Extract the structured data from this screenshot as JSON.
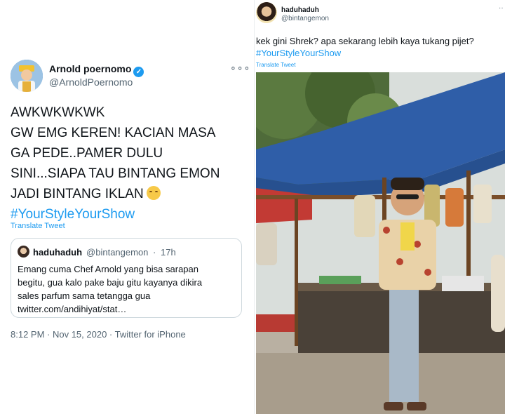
{
  "left_tweet": {
    "display_name": "Arnold poernomo",
    "verified_mark": "✓",
    "handle": "@ArnoldPoernomo",
    "more": "∘∘∘",
    "lines": [
      "AWKWKWKWK",
      "GW EMG KEREN! KACIAN MASA",
      "GA PEDE..PAMER DULU",
      "SINI...SIAPA TAU BINTANG EMON",
      "JADI BINTANG IKLAN"
    ],
    "hashtag": "#YourStyleYourShow",
    "translate": "Translate Tweet",
    "quoted": {
      "name": "haduhaduh",
      "handle": "@bintangemon",
      "separator": "·",
      "time": "17h",
      "lines": [
        "Emang cuma Chef Arnold yang bisa sarapan",
        "begitu, gua kalo pake baju gitu kayanya dikira",
        "sales parfum sama tetangga gua",
        "twitter.com/andihiyat/stat…"
      ]
    },
    "meta": "8:12 PM · Nov 15, 2020 · Twitter for iPhone"
  },
  "right_tweet": {
    "display_name": "haduhaduh",
    "handle": "@bintangemon",
    "more": "··",
    "text": "kek gini Shrek? apa sekarang lebih kaya tukang pijet?",
    "hashtag": "#YourStyleYourShow",
    "translate": "Translate Tweet"
  },
  "colors": {
    "link": "#1d9bf0",
    "secondary_text": "#536471",
    "border": "#cfd9de"
  }
}
